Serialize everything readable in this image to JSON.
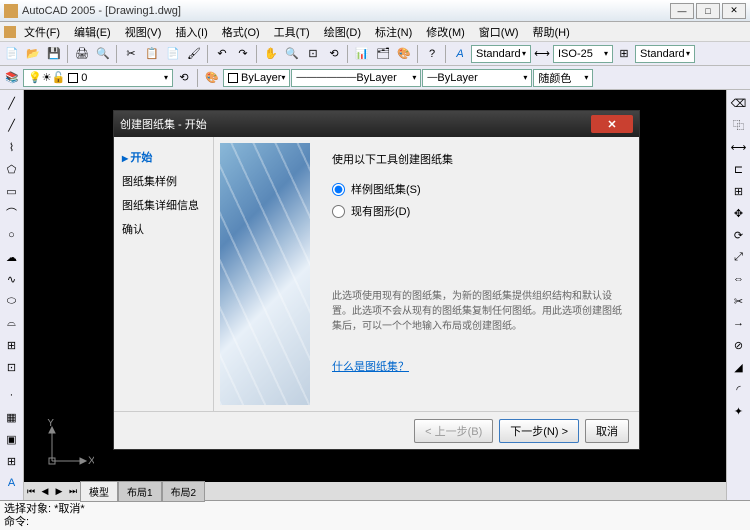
{
  "window": {
    "title": "AutoCAD 2005 - [Drawing1.dwg]"
  },
  "menu": {
    "file": "文件(F)",
    "edit": "编辑(E)",
    "view": "视图(V)",
    "insert": "插入(I)",
    "format": "格式(O)",
    "tools": "工具(T)",
    "draw": "绘图(D)",
    "dim": "标注(N)",
    "modify": "修改(M)",
    "window": "窗口(W)",
    "help": "帮助(H)"
  },
  "toolbar1": {
    "style1": "Standard",
    "style2": "ISO-25",
    "style3": "Standard"
  },
  "toolbar2": {
    "layer": "0",
    "linetype": "ByLayer",
    "lineweight": "ByLayer",
    "color_by": "ByLayer",
    "plotstyle": "随颜色"
  },
  "tabs": {
    "model": "模型",
    "layout1": "布局1",
    "layout2": "布局2"
  },
  "cmd": {
    "line1": "选择对象:  *取消*",
    "line2": "命令:"
  },
  "dialog": {
    "title": "创建图纸集 - 开始",
    "nav": {
      "begin": "开始",
      "example": "图纸集样例",
      "detail": "图纸集详细信息",
      "confirm": "确认"
    },
    "heading": "使用以下工具创建图纸集",
    "radio1": "样例图纸集(S)",
    "radio2": "现有图形(D)",
    "desc": "此选项使用现有的图纸集，为新的图纸集提供组织结构和默认设置。此选项不会从现有的图纸集复制任何图纸。用此选项创建图纸集后，可以一个个地输入布局或创建图纸。",
    "link": "什么是图纸集？",
    "btn_back": "< 上一步(B)",
    "btn_next": "下一步(N) >",
    "btn_cancel": "取消"
  },
  "ucs": {
    "x": "X",
    "y": "Y"
  }
}
